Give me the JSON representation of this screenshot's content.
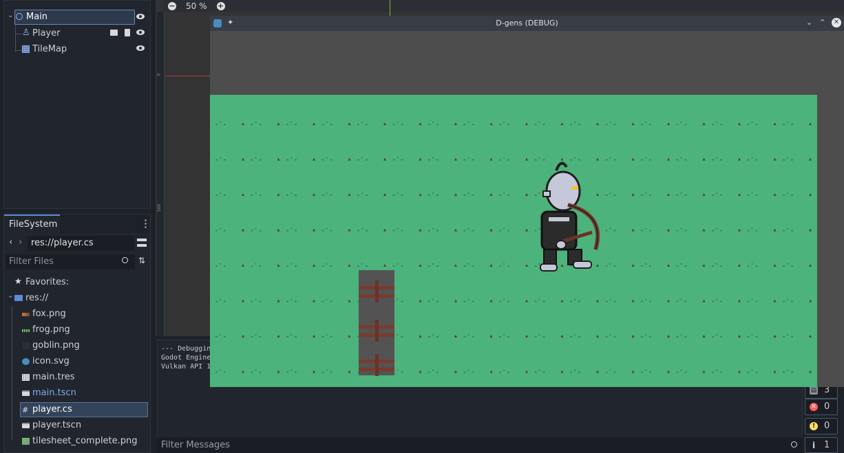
{
  "scene_tree": {
    "nodes": [
      {
        "label": "Main",
        "selected": true
      },
      {
        "label": "Player"
      },
      {
        "label": "TileMap"
      }
    ]
  },
  "filesystem": {
    "tab_label": "FileSystem",
    "path_value": "res://player.cs",
    "filter_placeholder": "Filter Files",
    "favorites_label": "Favorites:",
    "root_label": "res://",
    "files": [
      {
        "label": "fox.png",
        "icon": "image-icon"
      },
      {
        "label": "frog.png",
        "icon": "image-icon"
      },
      {
        "label": "goblin.png",
        "icon": "image-icon"
      },
      {
        "label": "icon.svg",
        "icon": "godot-icon"
      },
      {
        "label": "main.tres",
        "icon": "tileset-icon"
      },
      {
        "label": "main.tscn",
        "icon": "scene-icon",
        "highlight": true
      },
      {
        "label": "player.cs",
        "icon": "csharp-icon",
        "selected": true
      },
      {
        "label": "player.tscn",
        "icon": "scene-icon"
      },
      {
        "label": "tilesheet_complete.png",
        "icon": "image-icon"
      }
    ]
  },
  "viewport": {
    "zoom_label": "50 %",
    "ruler_marks": [
      "0",
      "500"
    ]
  },
  "output": {
    "lines": [
      "--- Debugging",
      "Godot Engine",
      "Vulkan API 1"
    ],
    "filter_placeholder": "Filter Messages",
    "counts": {
      "messages": "3",
      "errors": "0",
      "warnings": "0",
      "info": "1"
    }
  },
  "game_window": {
    "title": "D-gens (DEBUG)"
  },
  "colors": {
    "accent": "#5d8cd9",
    "grass": "#4cb37c",
    "selection": "#2d3a4d",
    "error": "#ff5d5d",
    "warning": "#ffdd65"
  }
}
